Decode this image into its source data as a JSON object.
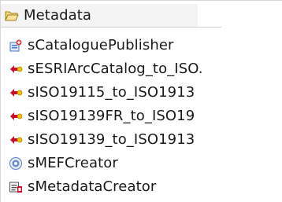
{
  "tree": {
    "folder": {
      "label": "Metadata",
      "icon": "folder-open-icon"
    },
    "items": [
      {
        "label": "sCataloguePublisher",
        "icon": "catalogue-publisher-icon"
      },
      {
        "label": "sESRIArcCatalog_to_ISO.",
        "icon": "transform-icon"
      },
      {
        "label": "sISO19115_to_ISO1913",
        "icon": "transform-icon"
      },
      {
        "label": "sISO19139FR_to_ISO19",
        "icon": "transform-icon"
      },
      {
        "label": "sISO19139_to_ISO1913",
        "icon": "transform-icon"
      },
      {
        "label": "sMEFCreator",
        "icon": "ngo-badge-icon"
      },
      {
        "label": "sMetadataCreator",
        "icon": "metadata-creator-icon"
      }
    ]
  },
  "colors": {
    "folder_fill": "#f2d779",
    "folder_stroke": "#a08020",
    "transform_red": "#c8102e",
    "transform_yellow": "#f5c000",
    "publisher_blue": "#4a78c8",
    "badge_blue": "#6c8cc8"
  }
}
